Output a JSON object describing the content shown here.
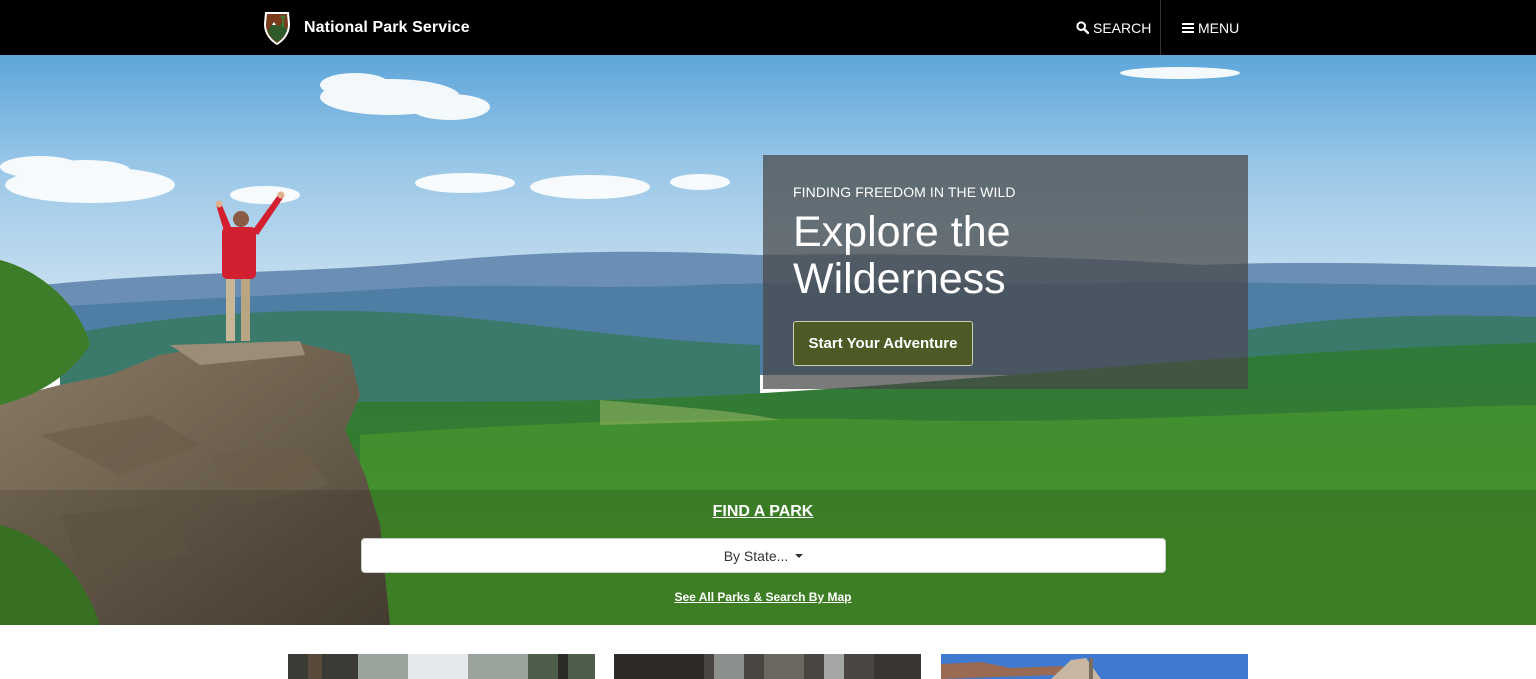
{
  "header": {
    "brand_name": "National Park Service",
    "search_label": "SEARCH",
    "menu_label": "MENU"
  },
  "hero": {
    "kicker": "FINDING FREEDOM IN THE WILD",
    "title": "Explore the Wilderness",
    "cta_label": "Start Your Adventure"
  },
  "find_park": {
    "title": "FIND A PARK",
    "select_value": "By State...",
    "see_all_link": "See All Parks & Search By Map"
  },
  "colors": {
    "header_bg": "#000000",
    "cta_bg": "#4d5a26"
  }
}
